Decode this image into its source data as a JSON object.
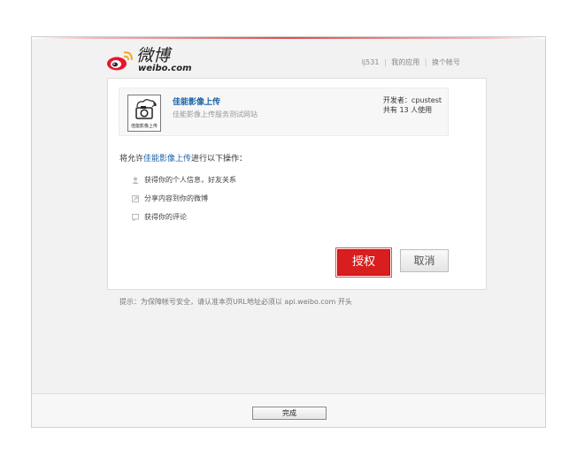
{
  "header": {
    "logo_text": "微博",
    "logo_sub": "weibo.com",
    "user_links": [
      "lj531",
      "我的应用",
      "换个帐号"
    ]
  },
  "app": {
    "name": "佳能影像上传",
    "description": "佳能影像上传服务测试网站",
    "icon_caption": "佳能影像上传",
    "developer_label": "开发者：cpustest",
    "users_label": "共有 13 人使用"
  },
  "permission": {
    "prefix": "将允许",
    "app_name": "佳能影像上传",
    "suffix": "进行以下操作：",
    "items": [
      {
        "label": "获得你的个人信息，好友关系",
        "icon": "user-icon"
      },
      {
        "label": "分享内容到你的微博",
        "icon": "share-icon"
      },
      {
        "label": "获得你的评论",
        "icon": "comment-icon"
      }
    ]
  },
  "actions": {
    "authorize_label": "授权",
    "cancel_label": "取消"
  },
  "hint": "提示：为保障帐号安全，请认准本页URL地址必须以 api.weibo.com 开头",
  "footer": {
    "done_label": "完成"
  },
  "colors": {
    "accent_red": "#d81e1e",
    "link_blue": "#1a62a8"
  }
}
